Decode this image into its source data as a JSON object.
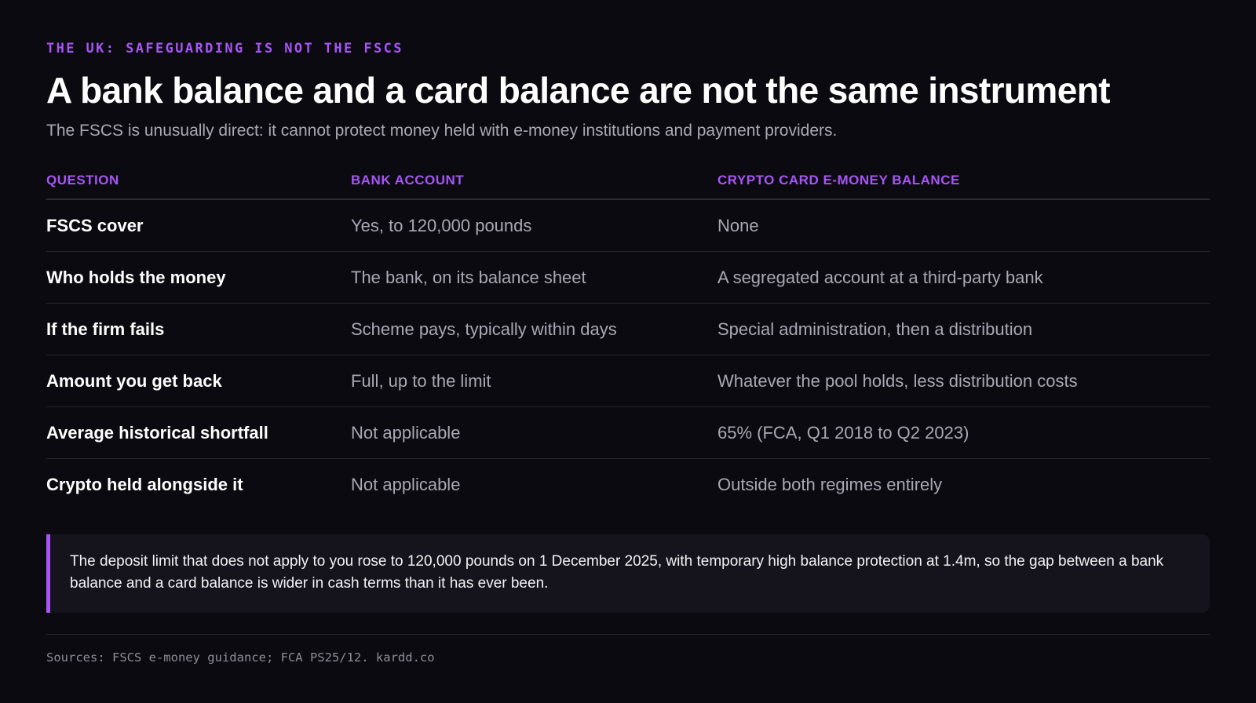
{
  "header": {
    "eyebrow": "THE UK: SAFEGUARDING IS NOT THE FSCS",
    "title": "A bank balance and a card balance are not the same instrument",
    "subtitle": "The FSCS is unusually direct: it cannot protect money held with e-money institutions and payment providers."
  },
  "table": {
    "columns": [
      "QUESTION",
      "BANK ACCOUNT",
      "CRYPTO CARD E-MONEY BALANCE"
    ],
    "rows": [
      {
        "question": "FSCS cover",
        "bank": "Yes, to 120,000 pounds",
        "card": "None"
      },
      {
        "question": "Who holds the money",
        "bank": "The bank, on its balance sheet",
        "card": "A segregated account at a third-party bank"
      },
      {
        "question": "If the firm fails",
        "bank": "Scheme pays, typically within days",
        "card": "Special administration, then a distribution"
      },
      {
        "question": "Amount you get back",
        "bank": "Full, up to the limit",
        "card": "Whatever the pool holds, less distribution costs"
      },
      {
        "question": "Average historical shortfall",
        "bank": "Not applicable",
        "card": "65% (FCA, Q1 2018 to Q2 2023)"
      },
      {
        "question": "Crypto held alongside it",
        "bank": "Not applicable",
        "card": "Outside both regimes entirely"
      }
    ]
  },
  "callout": {
    "text": "The deposit limit that does not apply to you rose to 120,000 pounds on 1 December 2025, with temporary high balance protection at 1.4m, so the gap between a bank balance and a card balance is wider in cash terms than it has ever been."
  },
  "footer": {
    "sources": "Sources: FSCS e-money guidance; FCA PS25/12. kardd.co"
  },
  "colors": {
    "background": "#0b0a10",
    "accent": "#a855f7",
    "muted_text": "#a9a8b3",
    "callout_bg": "#15141c"
  }
}
